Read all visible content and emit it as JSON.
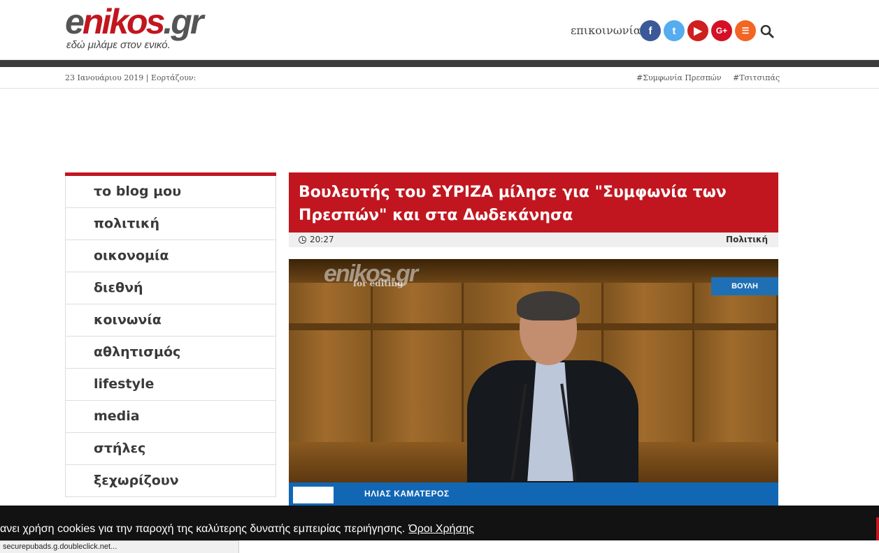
{
  "header": {
    "logo_main_e": "e",
    "logo_main_n": "nikos",
    "logo_main_gr": ".gr",
    "logo_tagline": "εδώ μιλάμε στον ενικό.",
    "contact_label": "επικοινωνία",
    "social_icons": [
      "facebook-icon",
      "twitter-icon",
      "youtube-icon",
      "google-plus-icon",
      "rss-icon",
      "search-icon"
    ],
    "social_glyphs": {
      "facebook": "f",
      "twitter": "t",
      "youtube": "▶",
      "google_plus": "G+",
      "rss": "☰"
    }
  },
  "subbar": {
    "date_line": "23 Ιανουάριου 2019 | Εορτάζουν:",
    "hashtags": [
      "#Συμφωνία Πρεσπών",
      "#Τσιτσιπάς"
    ]
  },
  "sidebar": {
    "items": [
      {
        "label": "το blog μου"
      },
      {
        "label": "πολιτική"
      },
      {
        "label": "οικονομία"
      },
      {
        "label": "διεθνή"
      },
      {
        "label": "κοινωνία"
      },
      {
        "label": "αθλητισμός"
      },
      {
        "label": "lifestyle"
      },
      {
        "label": "media"
      },
      {
        "label": "στήλες"
      },
      {
        "label": "ξεχωρίζουν"
      }
    ]
  },
  "article": {
    "headline": "Βουλευτής του ΣΥΡΙΖΑ μίλησε για \"Συμφωνία των Πρεσπών\" και στα Δωδεκάνησα",
    "time": "20:27",
    "category": "Πολιτική"
  },
  "video": {
    "watermark": "enikos.gr",
    "watermark_sub": "for editing",
    "channel_logo": "ΒΟΥΛΗ",
    "lower_third_name": "ΗΛΙΑΣ ΚΑΜΑΤΕΡΟΣ"
  },
  "cookie_bar": {
    "text": "ανει χρήση cookies για την παροχή της καλύτερης δυνατής εμπειρίας περιήγησης.",
    "link": "Όροι Χρήσης"
  },
  "browser_status": {
    "text": "securepubads.g.doubleclick.net..."
  },
  "colors": {
    "brand_red": "#c1161f",
    "dark_bar": "#3c3c3c",
    "facebook": "#3b5998",
    "twitter": "#55acee",
    "youtube": "#cd201f",
    "google_plus": "#d50f25",
    "rss": "#f26522"
  }
}
